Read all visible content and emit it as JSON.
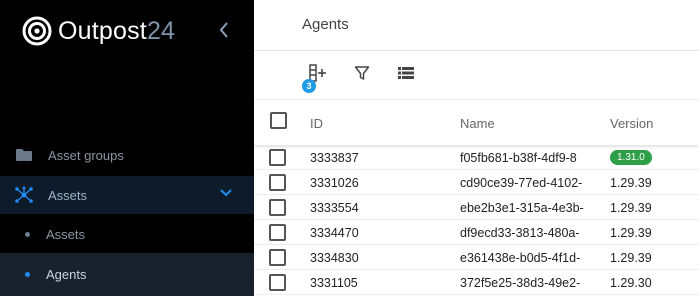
{
  "app": {
    "name": "Outpost",
    "name_suffix": "24"
  },
  "sidebar": {
    "collapse_icon": "chevron-left-icon",
    "items": [
      {
        "label": "Asset groups",
        "icon": "folder-icon"
      },
      {
        "label": "Assets",
        "icon": "network-icon",
        "expanded": true
      }
    ],
    "subitems": [
      {
        "label": "Assets",
        "active": false
      },
      {
        "label": "Agents",
        "active": true
      }
    ]
  },
  "main": {
    "title": "Agents",
    "toolbar": {
      "columns_icon": "columns-add-icon",
      "columns_badge": "3",
      "filter_icon": "filter-icon",
      "list_icon": "list-icon"
    },
    "table": {
      "columns": [
        "ID",
        "Name",
        "Version"
      ],
      "rows": [
        {
          "id": "3333837",
          "name": "f05fb681-b38f-4df9-8",
          "version": "1.31.0",
          "highlight": true
        },
        {
          "id": "3331026",
          "name": "cd90ce39-77ed-4102-",
          "version": "1.29.39"
        },
        {
          "id": "3333554",
          "name": "ebe2b3e1-315a-4e3b-",
          "version": "1.29.39"
        },
        {
          "id": "3334470",
          "name": "df9ecd33-3813-480a-",
          "version": "1.29.39"
        },
        {
          "id": "3334830",
          "name": "e361438e-b0d5-4f1d-",
          "version": "1.29.39"
        },
        {
          "id": "3331105",
          "name": "372f5e25-38d3-49e2-",
          "version": "1.29.30"
        }
      ]
    }
  },
  "colors": {
    "sidebar_bg": "#000000",
    "active_bg": "#18222d",
    "accent": "#1e8cf0",
    "badge_green": "#2e9e48"
  }
}
